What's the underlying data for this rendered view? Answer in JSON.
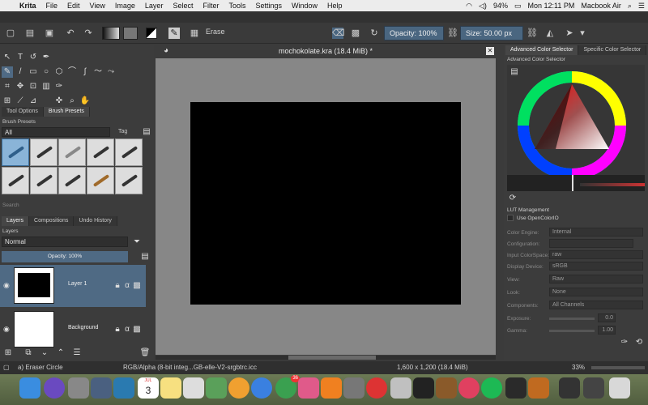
{
  "menubar": {
    "app": "Krita",
    "items": [
      "File",
      "Edit",
      "View",
      "Image",
      "Layer",
      "Select",
      "Filter",
      "Tools",
      "Settings",
      "Window",
      "Help"
    ],
    "battery": "94%",
    "clock": "Mon 12:11 PM",
    "device": "Macbook Air"
  },
  "toolbar": {
    "blend_mode": "Erase",
    "opacity_label": "Opacity: 100%",
    "size_label": "Size: 50.00 px"
  },
  "left": {
    "tabs": [
      "Tool Options",
      "Brush Presets"
    ],
    "brush_presets_title": "Brush Presets",
    "preset_filter": "All",
    "tag_label": "Tag",
    "search_label": "Search",
    "layer_tabs": [
      "Layers",
      "Compositions",
      "Undo History"
    ],
    "layers_title": "Layers",
    "blend": "Normal",
    "opacity": "Opacity: 100%",
    "layers": [
      {
        "name": "Layer 1"
      },
      {
        "name": "Background"
      }
    ]
  },
  "document": {
    "title": "mochokolate.kra (18.4 MiB) *"
  },
  "right": {
    "tabs": [
      "Advanced Color Selector",
      "Specific Color Selector"
    ],
    "selector_title": "Advanced Color Selector",
    "lut_title": "LUT Management",
    "use_ocio": "Use OpenColorIO",
    "fields": [
      {
        "label": "Color Engine:",
        "value": "Internal"
      },
      {
        "label": "Configuration:",
        "value": ""
      },
      {
        "label": "Input ColorSpace:",
        "value": "raw"
      },
      {
        "label": "Display Device:",
        "value": "sRGB"
      },
      {
        "label": "View:",
        "value": "Raw"
      },
      {
        "label": "Look:",
        "value": "None"
      },
      {
        "label": "Components:",
        "value": "All Channels"
      },
      {
        "label": "Exposure:",
        "value": "0.0"
      },
      {
        "label": "Gamma:",
        "value": "1.00"
      }
    ]
  },
  "status": {
    "brush": "a) Eraser Circle",
    "colorspace": "RGB/Alpha (8-bit integ...GB-elle-V2-srgbtrc.icc",
    "dimensions": "1,600 x 1,200 (18.4 MiB)",
    "zoom": "33%"
  },
  "dock": {
    "calendar_month": "JUL",
    "calendar_day": "3",
    "badge": "36"
  }
}
